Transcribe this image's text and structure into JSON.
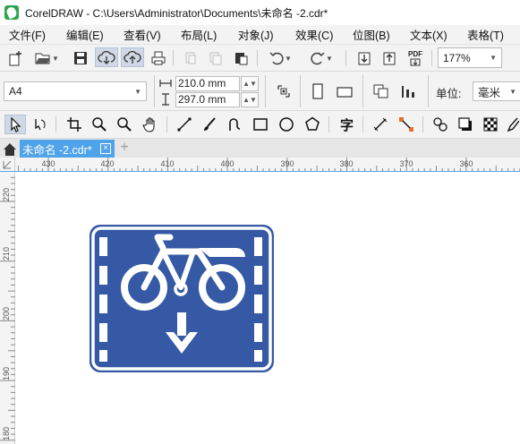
{
  "window": {
    "title": "CorelDRAW - C:\\Users\\Administrator\\Documents\\未命名 -2.cdr*"
  },
  "menu": [
    {
      "label": "文件(F)"
    },
    {
      "label": "编辑(E)"
    },
    {
      "label": "查看(V)"
    },
    {
      "label": "布局(L)"
    },
    {
      "label": "对象(J)"
    },
    {
      "label": "效果(C)"
    },
    {
      "label": "位图(B)"
    },
    {
      "label": "文本(X)"
    },
    {
      "label": "表格(T)"
    }
  ],
  "toolbar": {
    "zoom": "177%",
    "pdf_label": "PDF"
  },
  "property_bar": {
    "page_size": "A4",
    "width": "210.0 mm",
    "height": "297.0 mm",
    "unit_label": "单位:",
    "unit_value": "毫米"
  },
  "doc_tabs": {
    "active": "未命名 -2.cdr*",
    "close": "×",
    "add": "+"
  },
  "ruler": {
    "h_labels": [
      "430",
      "420",
      "410",
      "400",
      "390",
      "380",
      "370",
      "360"
    ],
    "v_labels": [
      "220",
      "210",
      "200",
      "190",
      "180"
    ]
  },
  "colors": {
    "sign_blue": "#3559a4",
    "sign_white": "#ffffff",
    "active_tab": "#4fa3e8"
  },
  "icons": [
    "new-document-icon",
    "open-folder-icon",
    "save-icon",
    "cloud-download-icon",
    "cloud-upload-icon",
    "print-icon",
    "cut-icon",
    "copy-icon",
    "paste-icon",
    "undo-icon",
    "redo-icon",
    "import-icon",
    "export-icon",
    "pdf-icon"
  ]
}
